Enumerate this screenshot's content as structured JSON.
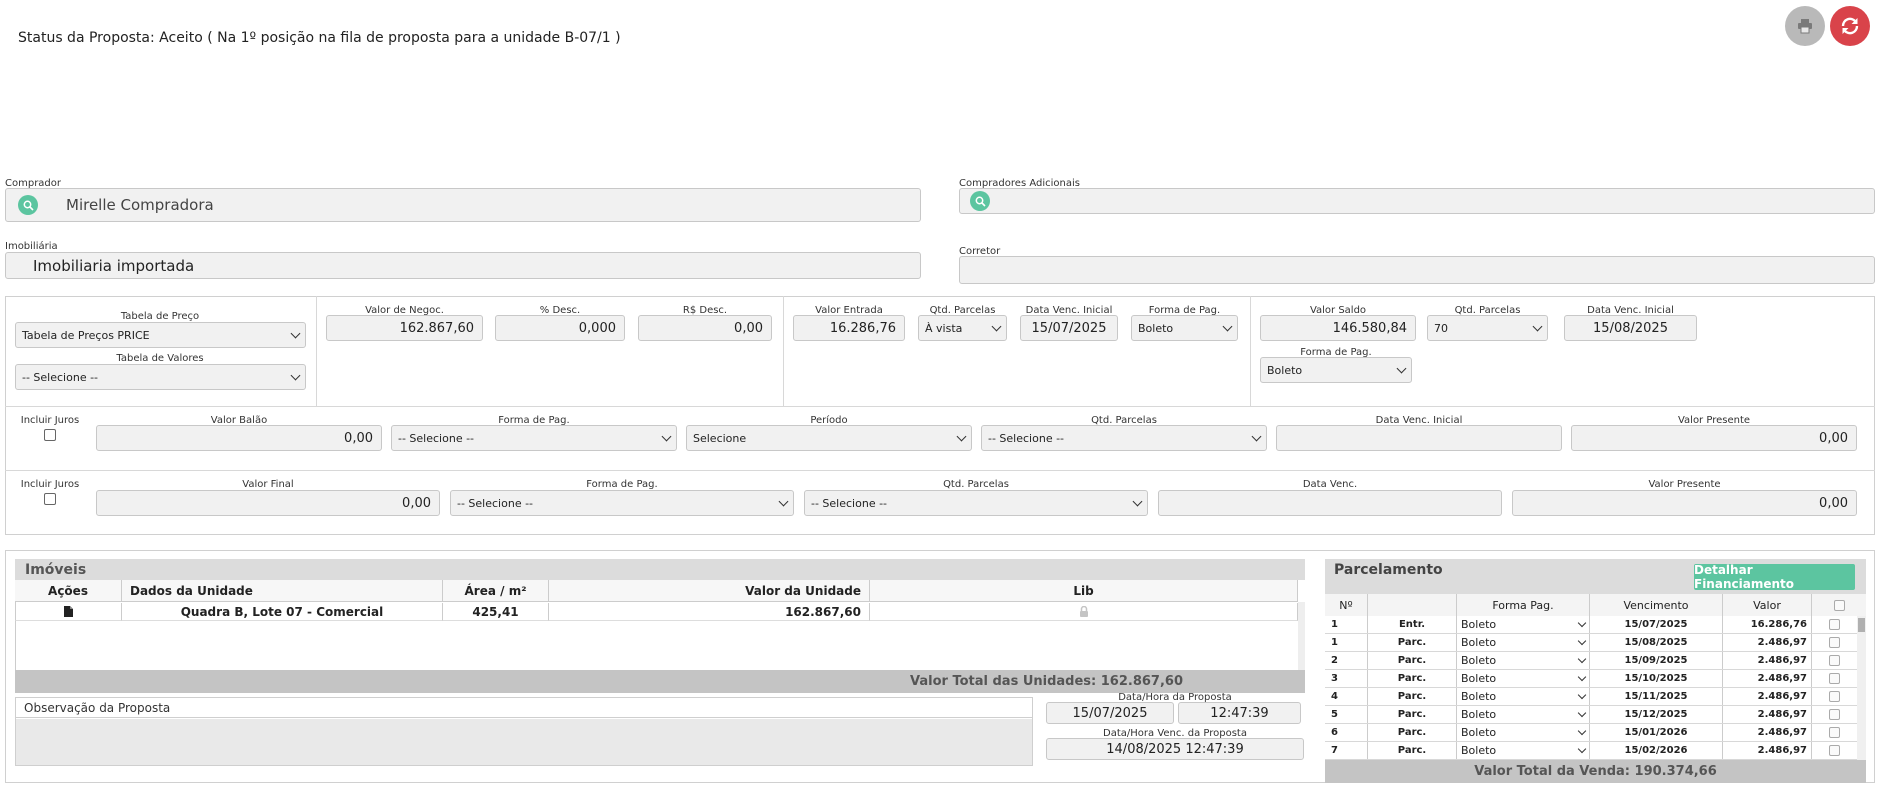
{
  "header": {
    "status": "Status da Proposta: Aceito ( Na 1º posição na fila de proposta para a unidade B-07/1 )",
    "print_icon": "printer-icon",
    "refresh_icon": "refresh-icon",
    "colors": {
      "print": "#b9b9b9",
      "refresh": "#d9434a",
      "accent": "#5cc5a0"
    }
  },
  "comprador": {
    "label": "Comprador",
    "value": "Mirelle Compradora"
  },
  "compradores_adicionais": {
    "label": "Compradores Adicionais",
    "value": ""
  },
  "imobiliaria": {
    "label": "Imobiliária",
    "value": "Imobiliaria importada"
  },
  "corretor": {
    "label": "Corretor",
    "value": ""
  },
  "price": {
    "tabela_preco_label": "Tabela de Preço",
    "tabela_preco_value": "Tabela de Preços PRICE",
    "tabela_valores_label": "Tabela de Valores",
    "tabela_valores_value": "-- Selecione --"
  },
  "negociacao": {
    "valor_negoc_label": "Valor de Negoc.",
    "valor_negoc": "162.867,60",
    "pct_desc_label": "% Desc.",
    "pct_desc": "0,000",
    "rs_desc_label": "R$ Desc.",
    "rs_desc": "0,00"
  },
  "entrada": {
    "valor_label": "Valor Entrada",
    "valor": "16.286,76",
    "qtd_label": "Qtd. Parcelas",
    "qtd": "À vista",
    "data_label": "Data Venc. Inicial",
    "data": "15/07/2025",
    "forma_label": "Forma de Pag.",
    "forma": "Boleto"
  },
  "saldo": {
    "valor_label": "Valor Saldo",
    "valor": "146.580,84",
    "qtd_label": "Qtd. Parcelas",
    "qtd": "70",
    "data_label": "Data Venc. Inicial",
    "data": "15/08/2025",
    "forma_label": "Forma de Pag.",
    "forma": "Boleto"
  },
  "balao": {
    "incluir_label": "Incluir Juros",
    "valor_label": "Valor Balão",
    "valor": "0,00",
    "forma_label": "Forma de Pag.",
    "forma": "-- Selecione --",
    "periodo_label": "Período",
    "periodo": "Selecione",
    "qtd_label": "Qtd. Parcelas",
    "qtd": "-- Selecione --",
    "data_label": "Data Venc. Inicial",
    "data": "",
    "vp_label": "Valor Presente",
    "vp": "0,00"
  },
  "final": {
    "incluir_label": "Incluir Juros",
    "valor_label": "Valor Final",
    "valor": "0,00",
    "forma_label": "Forma de Pag.",
    "forma": "-- Selecione --",
    "qtd_label": "Qtd. Parcelas",
    "qtd": "-- Selecione --",
    "data_label": "Data Venc.",
    "data": "",
    "vp_label": "Valor Presente",
    "vp": "0,00"
  },
  "imoveis": {
    "title": "Imóveis",
    "columns": [
      "Ações",
      "Dados da Unidade",
      "Área / m²",
      "Valor da Unidade",
      "Lib"
    ],
    "rows": [
      {
        "dados": "Quadra B, Lote 07 - Comercial",
        "area": "425,41",
        "valor": "162.867,60"
      }
    ],
    "total": "Valor Total das Unidades: 162.867,60"
  },
  "observacao": {
    "label": "Observação da Proposta",
    "value": ""
  },
  "datahora": {
    "label": "Data/Hora da Proposta",
    "data": "15/07/2025",
    "hora": "12:47:39",
    "venc_label": "Data/Hora Venc. da Proposta",
    "venc": "14/08/2025 12:47:39"
  },
  "parcelamento": {
    "title": "Parcelamento",
    "detalhar_button": "Detalhar Financiamento",
    "columns": [
      "Nº",
      "",
      "Forma Pag.",
      "Vencimento",
      "Valor"
    ],
    "rows": [
      {
        "n": "1",
        "tipo": "Entr.",
        "forma": "Boleto",
        "venc": "15/07/2025",
        "valor": "16.286,76"
      },
      {
        "n": "1",
        "tipo": "Parc.",
        "forma": "Boleto",
        "venc": "15/08/2025",
        "valor": "2.486,97"
      },
      {
        "n": "2",
        "tipo": "Parc.",
        "forma": "Boleto",
        "venc": "15/09/2025",
        "valor": "2.486,97"
      },
      {
        "n": "3",
        "tipo": "Parc.",
        "forma": "Boleto",
        "venc": "15/10/2025",
        "valor": "2.486,97"
      },
      {
        "n": "4",
        "tipo": "Parc.",
        "forma": "Boleto",
        "venc": "15/11/2025",
        "valor": "2.486,97"
      },
      {
        "n": "5",
        "tipo": "Parc.",
        "forma": "Boleto",
        "venc": "15/12/2025",
        "valor": "2.486,97"
      },
      {
        "n": "6",
        "tipo": "Parc.",
        "forma": "Boleto",
        "venc": "15/01/2026",
        "valor": "2.486,97"
      },
      {
        "n": "7",
        "tipo": "Parc.",
        "forma": "Boleto",
        "venc": "15/02/2026",
        "valor": "2.486,97"
      }
    ],
    "total": "Valor Total da Venda: 190.374,66"
  }
}
